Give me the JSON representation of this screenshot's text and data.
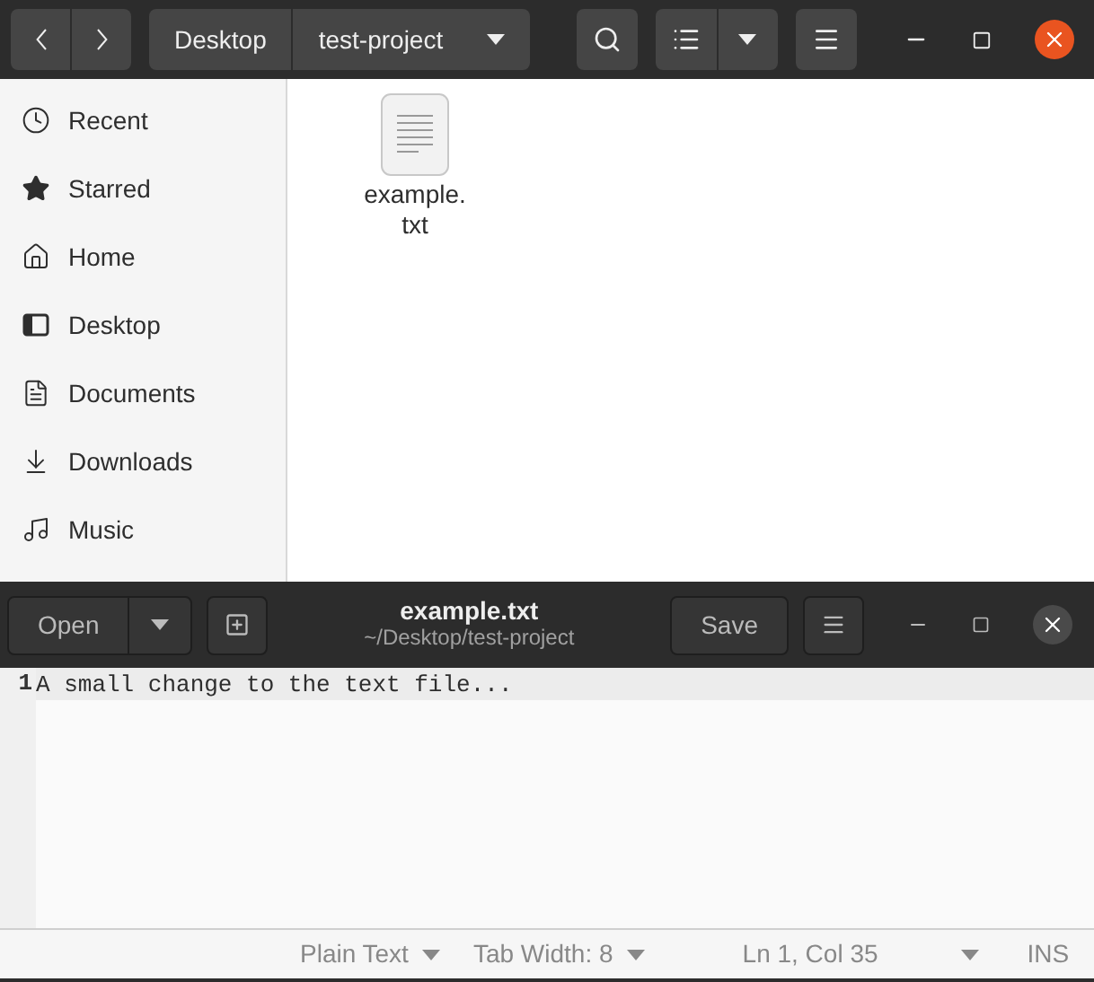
{
  "file_manager": {
    "path": [
      "Desktop",
      "test-project"
    ],
    "sidebar": [
      {
        "label": "Recent",
        "kind": "recent"
      },
      {
        "label": "Starred",
        "kind": "starred"
      },
      {
        "label": "Home",
        "kind": "home"
      },
      {
        "label": "Desktop",
        "kind": "desktop"
      },
      {
        "label": "Documents",
        "kind": "documents"
      },
      {
        "label": "Downloads",
        "kind": "downloads"
      },
      {
        "label": "Music",
        "kind": "music"
      }
    ],
    "files": [
      {
        "name": "example.\ntxt"
      }
    ]
  },
  "editor": {
    "open_button": "Open",
    "title": "example.txt",
    "subtitle": "~/Desktop/test-project",
    "save_button": "Save",
    "lines": [
      {
        "number": "1",
        "text": "A small change to the text file..."
      }
    ],
    "status_bar": {
      "language": "Plain Text",
      "tab_width": "Tab Width: 8",
      "position": "Ln 1, Col 35",
      "mode": "INS"
    }
  }
}
